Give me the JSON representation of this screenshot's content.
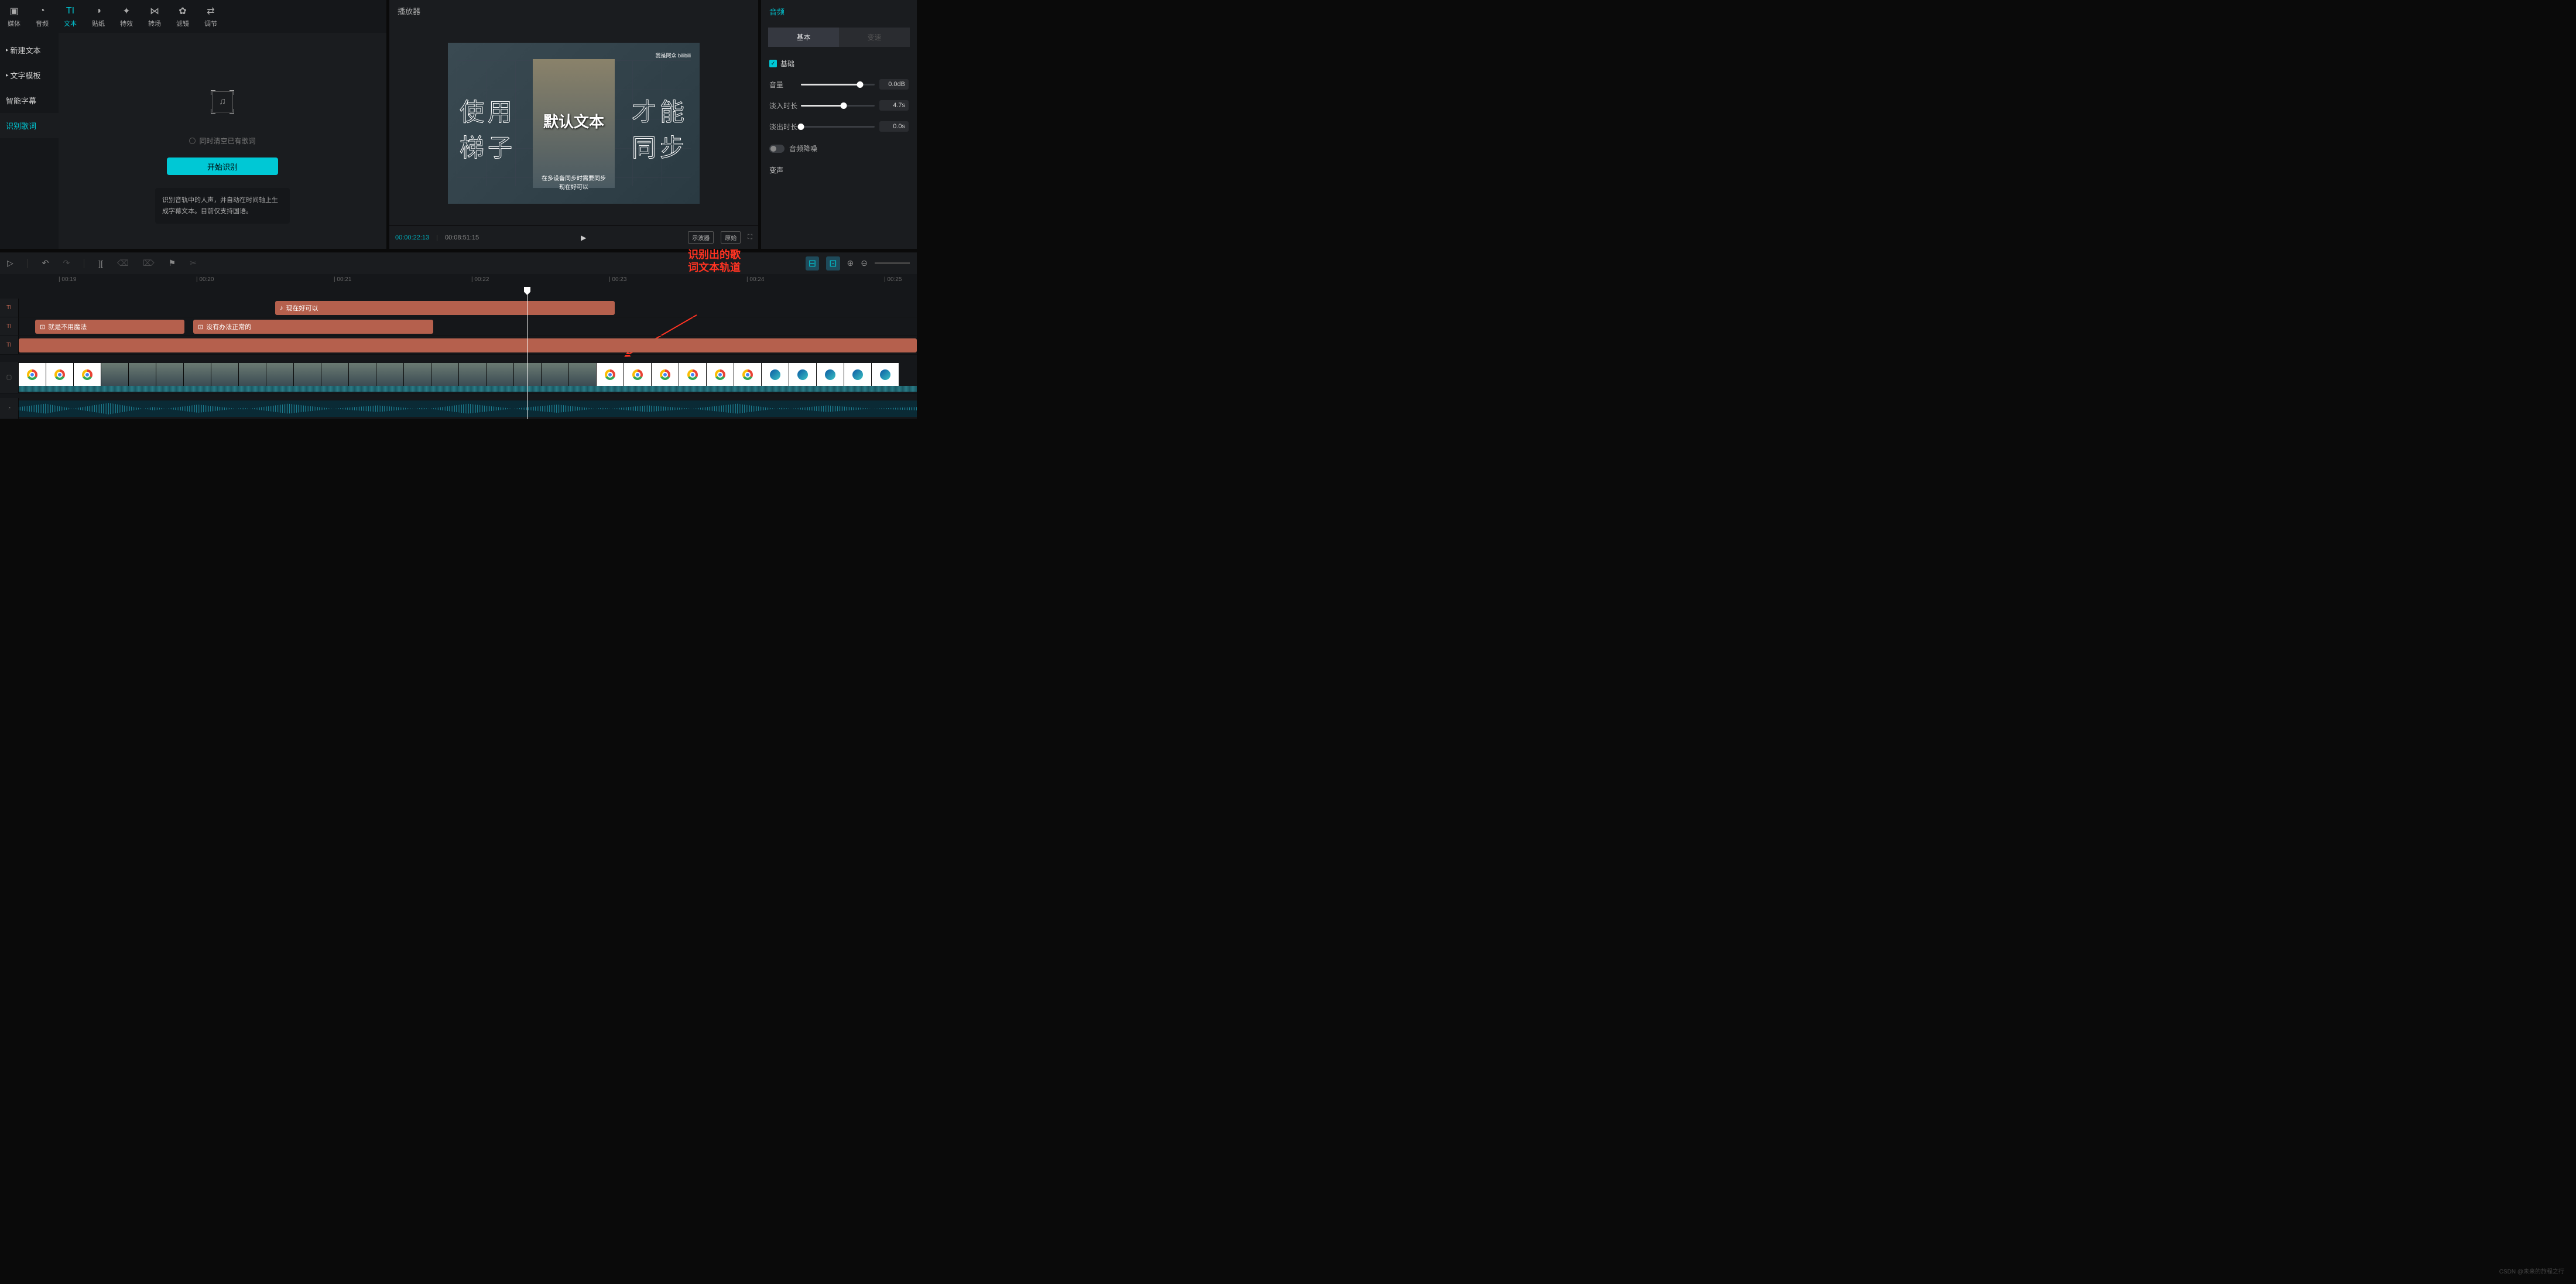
{
  "topTabs": [
    {
      "label": "媒体",
      "icon": "▣"
    },
    {
      "label": "音频",
      "icon": "◔"
    },
    {
      "label": "文本",
      "icon": "TI",
      "active": true
    },
    {
      "label": "贴纸",
      "icon": "◑"
    },
    {
      "label": "特效",
      "icon": "✦"
    },
    {
      "label": "转场",
      "icon": "⋈"
    },
    {
      "label": "滤镜",
      "icon": "✿"
    },
    {
      "label": "调节",
      "icon": "⇄"
    }
  ],
  "sideItems": [
    {
      "label": "新建文本",
      "caret": "▸"
    },
    {
      "label": "文字模板",
      "caret": "▸"
    },
    {
      "label": "智能字幕"
    },
    {
      "label": "识别歌词",
      "active": true
    }
  ],
  "recognize": {
    "checkboxLabel": "同时清空已有歌词",
    "button": "开始识别",
    "desc": "识别音轨中的人声，并自动在时间轴上生成字幕文本。目前仅支持国语。"
  },
  "player": {
    "title": "播放器",
    "outlineLeft1": "使用",
    "outlineLeft2": "梯子",
    "outlineRight1": "才能",
    "outlineRight2": "同步",
    "centerText": "默认文本",
    "subCaption1": "在多设备同步时需要同步",
    "subCaption2": "现在好可以",
    "watermark": "我是阿众 bilibili",
    "tcCurrent": "00:00:22:13",
    "tcTotal": "00:08:51:15",
    "btn1": "示波器",
    "btn2": "原始"
  },
  "inspector": {
    "title": "音频",
    "tab1": "基本",
    "tab2": "变速",
    "basicLabel": "基础",
    "volume": {
      "label": "音量",
      "value": "0.0dB",
      "pct": 80
    },
    "fadeIn": {
      "label": "淡入时长",
      "value": "4.7s",
      "pct": 58
    },
    "fadeOut": {
      "label": "淡出时长",
      "value": "0.0s",
      "pct": 0
    },
    "denoise": "音频降噪",
    "voiceChange": "变声"
  },
  "annotation": {
    "line1": "识别出的歌",
    "line2": "词文本轨道"
  },
  "ruler": [
    "00:19",
    "00:20",
    "00:21",
    "00:22",
    "00:23",
    "00:24",
    "00:25"
  ],
  "clips": {
    "lyric1": "现在好可以",
    "lyric2": "就是不用魔法",
    "lyric3": "没有办法正常的"
  },
  "watermarkGlobal": "CSDN @未来的旅程之行"
}
